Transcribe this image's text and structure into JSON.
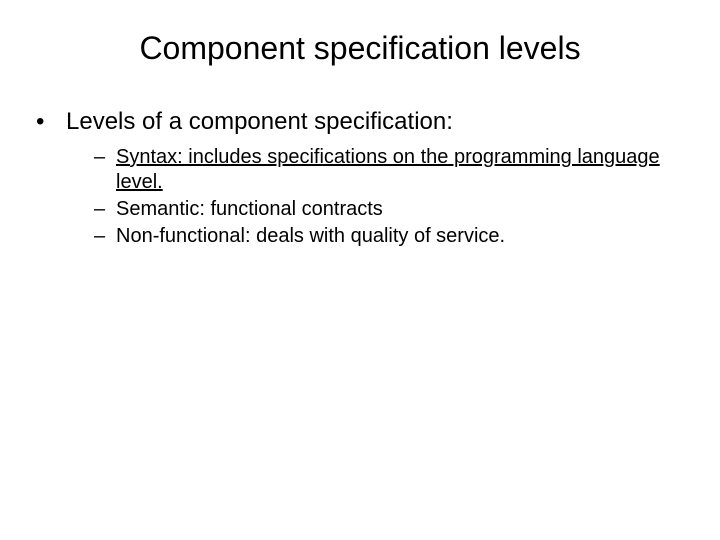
{
  "title": "Component specification levels",
  "bullet_l1": "Levels of  a component specification:",
  "sub_bullets": [
    {
      "text": "Syntax: includes specifications on the programming language level.",
      "underline": true
    },
    {
      "text": "Semantic: functional contracts",
      "underline": false
    },
    {
      "text": "Non-functional: deals with quality of service.",
      "underline": false
    }
  ],
  "markers": {
    "l1": "•",
    "l2": "–"
  }
}
